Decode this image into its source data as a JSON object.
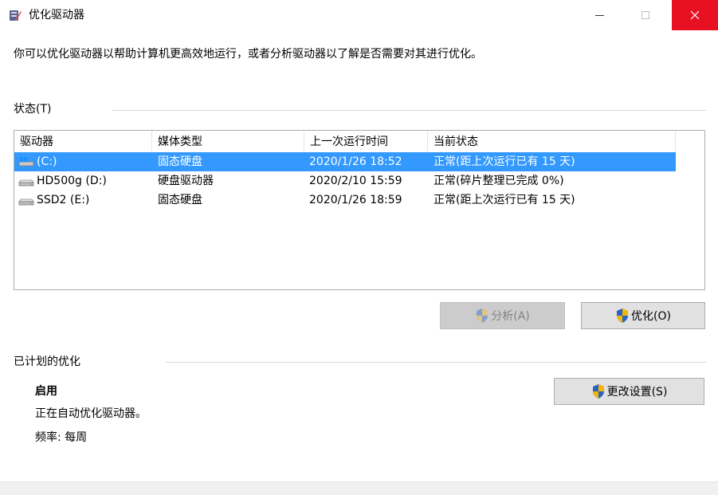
{
  "window": {
    "title": "优化驱动器",
    "description": "你可以优化驱动器以帮助计算机更高效地运行，或者分析驱动器以了解是否需要对其进行优化。"
  },
  "status": {
    "label": "状态(T)",
    "columns": [
      "驱动器",
      "媒体类型",
      "上一次运行时间",
      "当前状态"
    ],
    "drives": [
      {
        "name": "(C:)",
        "media": "固态硬盘",
        "last_run": "2020/1/26 18:52",
        "state": "正常(距上次运行已有 15 天)",
        "selected": true,
        "icon": "system-drive-icon"
      },
      {
        "name": "HD500g (D:)",
        "media": "硬盘驱动器",
        "last_run": "2020/2/10 15:59",
        "state": "正常(碎片整理已完成 0%)",
        "selected": false,
        "icon": "hard-drive-icon"
      },
      {
        "name": "SSD2 (E:)",
        "media": "固态硬盘",
        "last_run": "2020/1/26 18:59",
        "state": "正常(距上次运行已有 15 天)",
        "selected": false,
        "icon": "hard-drive-icon"
      }
    ]
  },
  "buttons": {
    "analyze": "分析(A)",
    "optimize": "优化(O)",
    "change_settings": "更改设置(S)"
  },
  "scheduled": {
    "label": "已计划的优化",
    "state": "启用",
    "detail": "正在自动优化驱动器。",
    "frequency": "频率: 每周"
  },
  "colors": {
    "selection": "#3399ff",
    "close_hover": "#e81123",
    "button_bg": "#e1e1e1",
    "disabled_button_bg": "#cccccc"
  }
}
